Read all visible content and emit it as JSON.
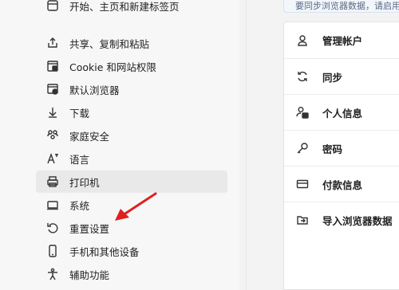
{
  "sidebar": {
    "items": [
      {
        "label": "开始、主页和新建标签页",
        "icon": "start-home-icon"
      },
      {
        "label": "共享、复制和粘贴",
        "icon": "share-icon"
      },
      {
        "label": "Cookie 和网站权限",
        "icon": "cookie-permissions-icon"
      },
      {
        "label": "默认浏览器",
        "icon": "default-browser-icon"
      },
      {
        "label": "下载",
        "icon": "download-icon"
      },
      {
        "label": "家庭安全",
        "icon": "family-icon"
      },
      {
        "label": "语言",
        "icon": "language-icon"
      },
      {
        "label": "打印机",
        "icon": "printer-icon"
      },
      {
        "label": "系统",
        "icon": "system-icon"
      },
      {
        "label": "重置设置",
        "icon": "reset-icon"
      },
      {
        "label": "手机和其他设备",
        "icon": "phone-icon"
      },
      {
        "label": "辅助功能",
        "icon": "accessibility-icon"
      }
    ],
    "selected_index": 7
  },
  "banner_text": "要同步浏览器数据，请启用",
  "profile_menu": {
    "items": [
      {
        "label": "管理帐户",
        "icon": "person-icon"
      },
      {
        "label": "同步",
        "icon": "sync-icon"
      },
      {
        "label": "个人信息",
        "icon": "personal-info-icon"
      },
      {
        "label": "密码",
        "icon": "key-icon"
      },
      {
        "label": "付款信息",
        "icon": "card-icon"
      },
      {
        "label": "导入浏览器数据",
        "icon": "import-icon"
      }
    ]
  },
  "annotation_color": "#e02020"
}
